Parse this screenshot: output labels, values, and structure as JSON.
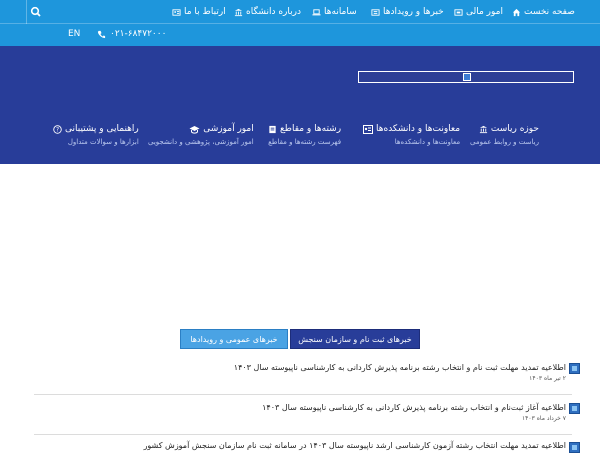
{
  "colors": {
    "topbar": "#1e96dc",
    "banner": "#283d99",
    "tab_active": "#4aa3e4",
    "tab_inactive": "#283d99"
  },
  "nav": {
    "home": "صفحه نخست",
    "finance": "امور مالی",
    "news_events": "خبرها و رویدادها",
    "systems": "سامانه‌ها",
    "about": "درباره دانشگاه",
    "contact": "ارتباط با ما"
  },
  "row2": {
    "phone": "۰۲۱-۶۸۴۷۲۰۰۰",
    "lang": "EN"
  },
  "mega": [
    {
      "title": "حوزه ریاست",
      "sub": "ریاست و روابط عمومی",
      "icon": "bank-icon"
    },
    {
      "title": "معاونت‌ها و دانشکده‌ها",
      "sub": "معاونت‌ها و دانشکده‌ها",
      "icon": "id-card-icon"
    },
    {
      "title": "رشته‌ها و مقاطع",
      "sub": "فهرست رشته‌ها و مقاطع",
      "icon": "book-icon"
    },
    {
      "title": "امور آموزشی",
      "sub": "امور آموزشی، پژوهشی و دانشجویی",
      "icon": "graduation-cap-icon"
    },
    {
      "title": "راهنمایی و پشتیبانی",
      "sub": "ابزارها و سوالات متداول",
      "icon": "help-circle-icon"
    }
  ],
  "tabs": {
    "active": "خبرهای عمومی و رویدادها",
    "second": "خبرهای ثبت نام و سازمان سنجش"
  },
  "news": [
    {
      "title": "اطلاعیه تمدید مهلت ثبت نام و انتخاب رشته برنامه پذیرش کاردانی به کارشناسی ناپیوسته سال ۱۴۰۳",
      "date": "۲ تیر ماه ۱۴۰۳"
    },
    {
      "title": "اطلاعیه آغاز ثبت‌نام و انتخاب رشته برنامه پذیرش کاردانی به کارشناسی ناپیوسته سال ۱۴۰۳",
      "date": "۷ خرداد ماه ۱۴۰۳"
    },
    {
      "title": "اطلاعیه تمدید مهلت انتخاب رشته آزمون کارشناسی ارشد ناپیوسته سال ۱۴۰۳ در سامانه ثبت نام سازمان سنجش آموزش کشور",
      "date": ""
    }
  ]
}
